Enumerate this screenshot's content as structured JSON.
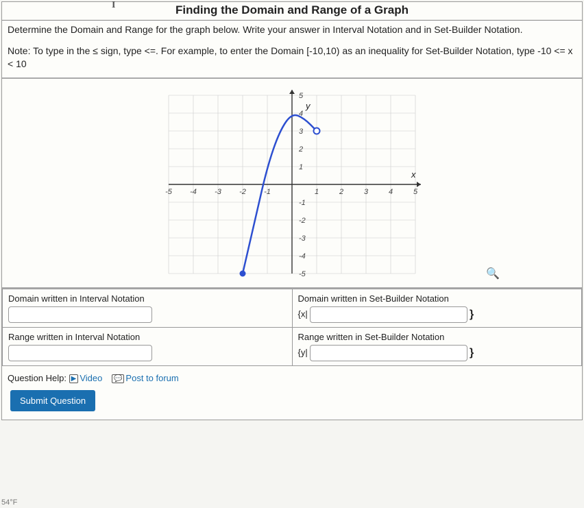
{
  "header": {
    "title": "Finding the Domain and Range of a Graph"
  },
  "instructions": "Determine the Domain and Range for the graph below. Write your answer in Interval Notation and in Set-Builder Notation.",
  "note_prefix": "Note: To type in the ",
  "note_sign": "≤",
  "note_mid": " sign, type <=. For example, to enter the Domain [-10,10) as an inequality for Set-Builder Notation, type -10 <= x < 10",
  "answers": {
    "domain_interval_label": "Domain written in Interval Notation",
    "domain_interval_value": "",
    "domain_set_label": "Domain written in Set-Builder Notation",
    "domain_set_prefix": "{x|",
    "domain_set_value": "",
    "domain_set_suffix": "}",
    "range_interval_label": "Range written in Interval Notation",
    "range_interval_value": "",
    "range_set_label": "Range written in Set-Builder Notation",
    "range_set_prefix": "{y|",
    "range_set_value": "",
    "range_set_suffix": "}"
  },
  "help": {
    "label": "Question Help:",
    "video": "Video",
    "forum": "Post to forum"
  },
  "submit": "Submit Question",
  "chart_data": {
    "type": "line",
    "title": "",
    "xlabel": "x",
    "ylabel": "y",
    "xlim": [
      -5,
      5
    ],
    "ylim": [
      -5,
      5
    ],
    "x_ticks": [
      -5,
      -4,
      -3,
      -2,
      -1,
      1,
      2,
      3,
      4,
      5
    ],
    "y_ticks": [
      -5,
      -4,
      -3,
      -2,
      -1,
      1,
      2,
      3,
      4,
      5
    ],
    "curve_points": [
      {
        "x": -2,
        "y": -5
      },
      {
        "x": -1.5,
        "y": -2
      },
      {
        "x": -1,
        "y": 1
      },
      {
        "x": -0.5,
        "y": 3
      },
      {
        "x": 0,
        "y": 4
      },
      {
        "x": 0.5,
        "y": 3.7
      },
      {
        "x": 1,
        "y": 3
      }
    ],
    "endpoints": [
      {
        "x": -2,
        "y": -5,
        "type": "closed"
      },
      {
        "x": 1,
        "y": 3,
        "type": "open"
      }
    ]
  },
  "taskbar": {
    "temp": "54°F"
  }
}
